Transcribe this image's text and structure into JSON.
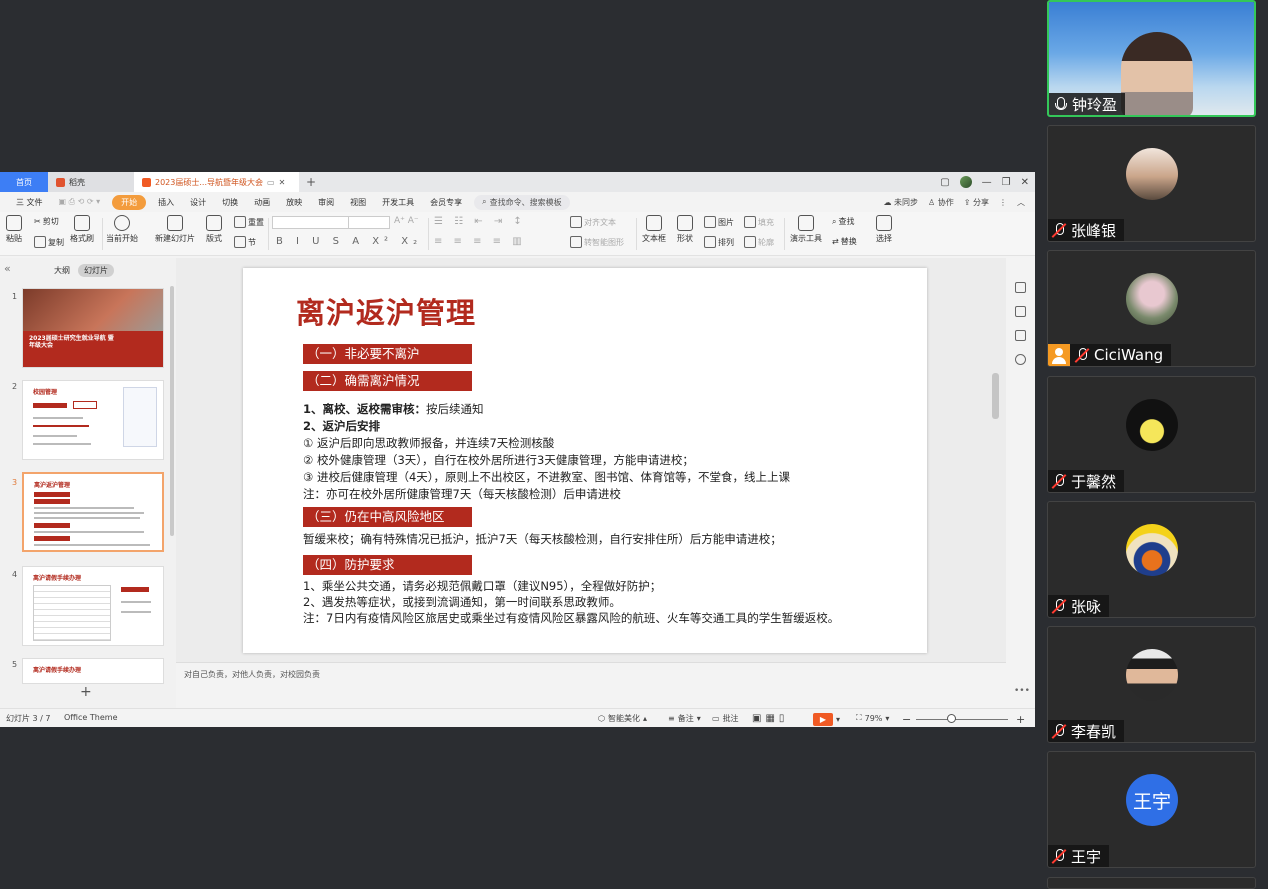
{
  "tabs": {
    "home": "首页",
    "docer": "稻壳",
    "doc": "2023届硕士...导航暨年级大会",
    "add": "+"
  },
  "menu": {
    "file": "三 文件",
    "items": [
      "开始",
      "插入",
      "设计",
      "切换",
      "动画",
      "放映",
      "审阅",
      "视图",
      "开发工具",
      "会员专享"
    ],
    "search": "查找命令、搜索模板",
    "sync": "未同步",
    "collab": "协作",
    "share": "分享"
  },
  "ribbon": {
    "paste": "粘贴",
    "cut": "剪切",
    "copy": "复制",
    "format_painter": "格式刷",
    "from_current": "当前开始",
    "new_slide": "新建幻灯片",
    "layout": "版式",
    "reset": "重置",
    "section": "节",
    "align_text": "对齐文本",
    "convert_smartart": "转智能图形",
    "textbox": "文本框",
    "shape": "形状",
    "picture": "图片",
    "fill": "填充",
    "arrange": "排列",
    "outline": "轮廓",
    "show_tools": "演示工具",
    "find": "查找",
    "replace": "替换",
    "select": "选择"
  },
  "left_pane": {
    "tab_outline": "大纲",
    "tab_slides": "幻灯片",
    "thumbs": [
      {
        "num": "1",
        "title": "2023届硕士研究生就业导航 暨年级大会"
      },
      {
        "num": "2",
        "title": "校园管理"
      },
      {
        "num": "3",
        "title": "离沪返沪管理"
      },
      {
        "num": "4",
        "title": "离沪请假手续办理"
      },
      {
        "num": "5",
        "title": "离沪请假手续办理"
      }
    ]
  },
  "slide": {
    "title": "离沪返沪管理",
    "sec1": "（一）非必要不离沪",
    "sec2": "（二）确需离沪情况",
    "l1_bold": "1、离校、返校需审核：",
    "l1_rest": "按后续通知",
    "l2": "2、返沪后安排",
    "l3": "① 返沪后即向思政教师报备，并连续7天检测核酸",
    "l4": "② 校外健康管理（3天），自行在校外居所进行3天健康管理，方能申请进校；",
    "l5": "③ 进校后健康管理（4天），原则上不出校区，不进教室、图书馆、体育馆等，不堂食，线上上课",
    "l6": "注：亦可在校外居所健康管理7天（每天核酸检测）后申请进校",
    "sec3": "（三）仍在中高风险地区",
    "l7": "暂缓来校；确有特殊情况已抵沪，抵沪7天（每天核酸检测，自行安排住所）后方能申请进校；",
    "sec4": "（四）防护要求",
    "l8": "1、乘坐公共交通，请务必规范佩戴口罩（建议N95），全程做好防护；",
    "l9": "2、遇发热等症状，或接到流调通知，第一时间联系思政教师。",
    "l10": "注：7日内有疫情风险区旅居史或乘坐过有疫情风险区暴露风险的航班、火车等交通工具的学生暂缓返校。"
  },
  "notes": "对自己负责，对他人负责，对校园负责",
  "status": {
    "slide_index": "幻灯片 3 / 7",
    "theme": "Office Theme",
    "smart": "智能美化",
    "notes_btn": "备注",
    "comment": "批注",
    "zoom": "79%"
  },
  "participants": [
    {
      "name": "钟玲盈",
      "muted": false
    },
    {
      "name": "张峰银",
      "muted": true
    },
    {
      "name": "CiciWang",
      "muted": true
    },
    {
      "name": "于馨然",
      "muted": true
    },
    {
      "name": "张咏",
      "muted": true
    },
    {
      "name": "李春凯",
      "muted": true
    },
    {
      "name": "王宇",
      "muted": true,
      "initials": "王宇"
    }
  ],
  "colors": {
    "accent_red": "#b22a1e",
    "wps_blue": "#3d7ef5",
    "start_orange": "#f39c3d",
    "active_green": "#34c759"
  }
}
